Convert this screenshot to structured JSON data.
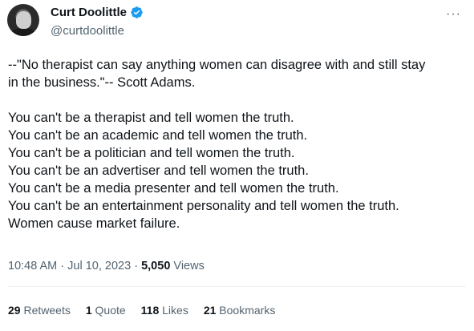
{
  "author": {
    "name": "Curt Doolittle",
    "handle": "@curtdoolittle",
    "verified_icon": "verified-badge-icon",
    "verified_color": "#1d9bf0"
  },
  "more_label": "···",
  "tweet": {
    "quote_lines": [
      "--\"No therapist can say anything women can disagree with and still stay",
      "in the business.\"-- Scott Adams."
    ],
    "lines": [
      "You can't be a therapist and tell women the truth.",
      "You can't be an academic and tell women the truth.",
      "You can't be a politician and tell women the truth.",
      "You can't be an advertiser and tell women the truth.",
      "You can't be a media presenter and tell women the truth.",
      "You can't be an entertainment personality and tell women the truth.",
      "Women cause market failure."
    ]
  },
  "meta": {
    "time": "10:48 AM",
    "date": "Jul 10, 2023",
    "separator": "·",
    "views_count": "5,050",
    "views_label": "Views"
  },
  "stats": {
    "retweets": {
      "count": "29",
      "label": "Retweets"
    },
    "quotes": {
      "count": "1",
      "label": "Quote"
    },
    "likes": {
      "count": "118",
      "label": "Likes"
    },
    "bookmarks": {
      "count": "21",
      "label": "Bookmarks"
    }
  },
  "colors": {
    "text": "#0f1419",
    "secondary": "#536471",
    "divider": "#eff3f4"
  }
}
